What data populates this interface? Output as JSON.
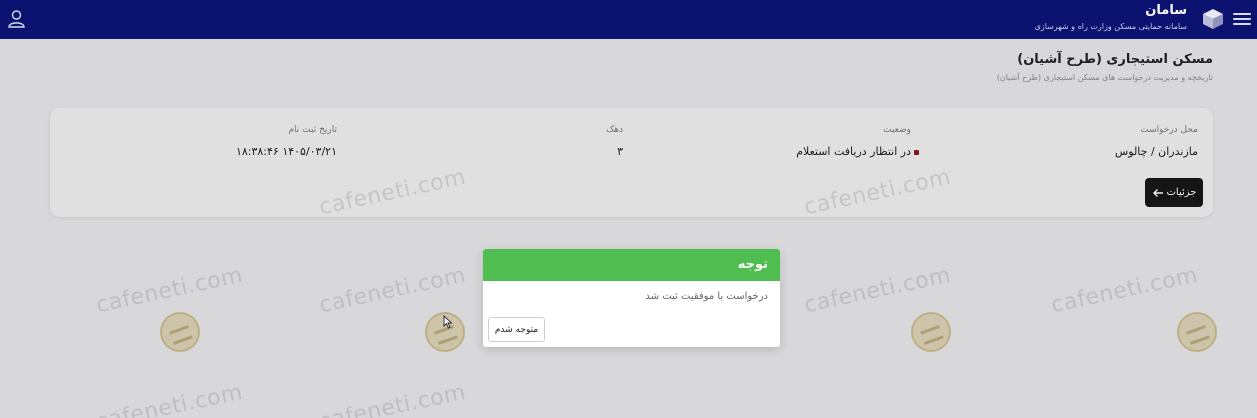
{
  "header": {
    "brand_title": "سامان",
    "brand_subtitle": "سامانه حمایتی مسکن وزارت راه و شهرسازی",
    "bg_color": "#0c1270"
  },
  "page": {
    "title": "مسکن استیجاری (طرح آشیان)",
    "subtitle": "تاریخچه و مدیریت درخواست های مسکن استیجاری (طرح آشیان)"
  },
  "request": {
    "location_label": "محل درخواست",
    "location_value": "مازندران / چالوس",
    "status_label": "وضعیت",
    "status_value": "در انتظار دریافت استعلام",
    "share_label": "دهک",
    "share_value": "۳",
    "date_label": "تاریخ ثبت نام",
    "date_value": "۱۴۰۵/۰۳/۲۱ ۱۸:۳۸:۴۶",
    "details_button": "جزئیات"
  },
  "watermark": {
    "text": "cafeneti.com"
  },
  "modal": {
    "title": "توجه",
    "message": "درخواست با موفقیت ثبت شد",
    "ok_button": "متوجه شدم",
    "header_color": "#4fbd4f"
  },
  "icons": {
    "menu": "menu-icon",
    "logo": "box-logo-icon",
    "user": "user-icon",
    "arrow": "arrow-left-icon"
  }
}
